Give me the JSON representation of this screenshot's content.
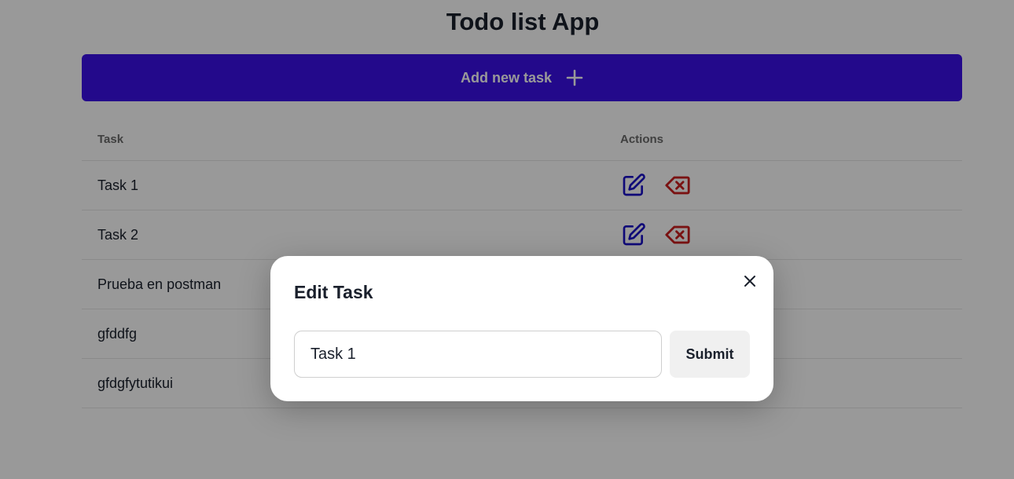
{
  "app": {
    "title": "Todo list App",
    "add_button_label": "Add new task"
  },
  "table": {
    "headers": {
      "task": "Task",
      "actions": "Actions"
    },
    "rows": [
      {
        "task": "Task 1"
      },
      {
        "task": "Task 2"
      },
      {
        "task": "Prueba en postman"
      },
      {
        "task": "gfddfg"
      },
      {
        "task": "gfdgfytutikui"
      }
    ]
  },
  "modal": {
    "title": "Edit Task",
    "input_value": "Task 1",
    "submit_label": "Submit"
  },
  "icons": {
    "add": "plus-icon",
    "edit": "edit-icon",
    "delete": "backspace-delete-icon",
    "close": "close-icon"
  },
  "colors": {
    "primary": "#3b0fe8",
    "edit_icon": "#1a10c9",
    "delete_icon": "#cc1f1f",
    "overlay": "rgba(0,0,0,0.40)",
    "submit_bg": "#f0f0f0"
  }
}
